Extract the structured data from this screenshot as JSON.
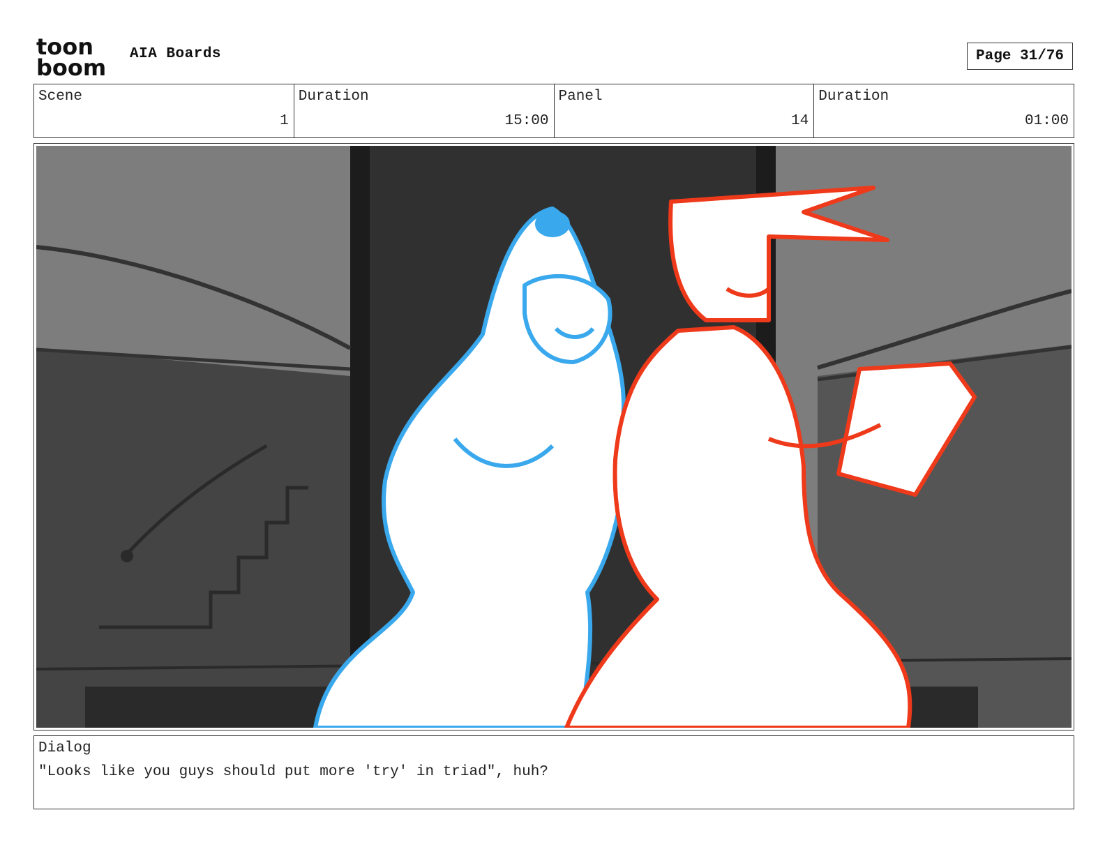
{
  "header": {
    "logo_text_top": "toon",
    "logo_text_bottom": "boom",
    "project_title": "AIA Boards",
    "page_label": "Page 31/76"
  },
  "info": [
    {
      "label": "Scene",
      "value": "1"
    },
    {
      "label": "Duration",
      "value": "15:00"
    },
    {
      "label": "Panel",
      "value": "14"
    },
    {
      "label": "Duration",
      "value": "01:00"
    }
  ],
  "panel": {
    "colors": {
      "background_gray": "#7a7a7a",
      "wall_dark": "#3d3d3d",
      "doorway": "#2e2e2e",
      "character_left_line": "#3aa8ec",
      "character_right_line": "#ee3a1a",
      "fill": "#ffffff"
    }
  },
  "dialog": {
    "label": "Dialog",
    "text": "\"Looks like you guys should put more 'try' in triad\", huh?"
  }
}
